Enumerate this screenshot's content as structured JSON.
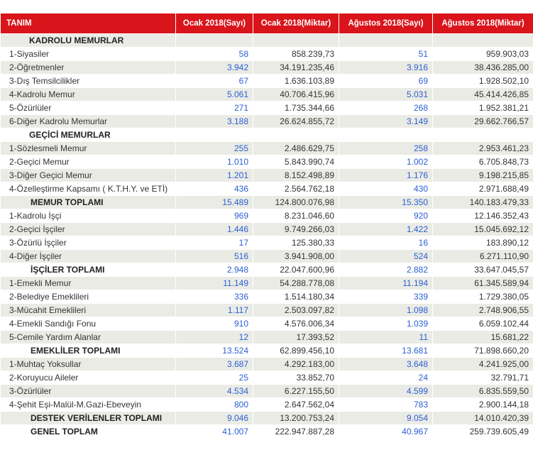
{
  "headers": [
    "TANIM",
    "Ocak 2018(Sayı)",
    "Ocak 2018(Miktar)",
    "Ağustos 2018(Sayı)",
    "Ağustos 2018(Miktar)"
  ],
  "rows": [
    {
      "type": "section",
      "name": "KADROLU MEMURLAR",
      "c1": "",
      "c2": "",
      "c3": "",
      "c4": ""
    },
    {
      "type": "item",
      "name": "1-Siyasiler",
      "c1": "58",
      "c2": "858.239,73",
      "c3": "51",
      "c4": "959.903,03"
    },
    {
      "type": "item",
      "name": "2-Öğretmenler",
      "c1": "3.942",
      "c2": "34.191.235,46",
      "c3": "3.916",
      "c4": "38.436.285,00"
    },
    {
      "type": "item",
      "name": "3-Dış Temsilcilikler",
      "c1": "67",
      "c2": "1.636.103,89",
      "c3": "69",
      "c4": "1.928.502,10"
    },
    {
      "type": "item",
      "name": "4-Kadrolu Memur",
      "c1": "5.061",
      "c2": "40.706.415,96",
      "c3": "5.031",
      "c4": "45.414.426,85"
    },
    {
      "type": "item",
      "name": "5-Özürlüler",
      "c1": "271",
      "c2": "1.735.344,66",
      "c3": "268",
      "c4": "1.952.381,21"
    },
    {
      "type": "item",
      "name": "6-Diğer Kadrolu Memurlar",
      "c1": "3.188",
      "c2": "26.624.855,72",
      "c3": "3.149",
      "c4": "29.662.766,57"
    },
    {
      "type": "section",
      "name": "GEÇİCİ MEMURLAR",
      "c1": "",
      "c2": "",
      "c3": "",
      "c4": ""
    },
    {
      "type": "item",
      "name": "1-Sözlesmeli Memur",
      "c1": "255",
      "c2": "2.486.629,75",
      "c3": "258",
      "c4": "2.953.461,23"
    },
    {
      "type": "item",
      "name": "2-Geçici Memur",
      "c1": "1.010",
      "c2": "5.843.990,74",
      "c3": "1.002",
      "c4": "6.705.848,73"
    },
    {
      "type": "item",
      "name": "3-Diğer Geçici Memur",
      "c1": "1.201",
      "c2": "8.152.498,89",
      "c3": "1.176",
      "c4": "9.198.215,85"
    },
    {
      "type": "item",
      "name": "4-Özelleştirme Kapsamı ( K.T.H.Y. ve ETİ)",
      "c1": "436",
      "c2": "2.564.762,18",
      "c3": "430",
      "c4": "2.971.688,49"
    },
    {
      "type": "total",
      "name": "MEMUR TOPLAMI",
      "c1": "15.489",
      "c2": "124.800.076,98",
      "c3": "15.350",
      "c4": "140.183.479,33"
    },
    {
      "type": "item",
      "name": "1-Kadrolu İşçi",
      "c1": "969",
      "c2": "8.231.046,60",
      "c3": "920",
      "c4": "12.146.352,43"
    },
    {
      "type": "item",
      "name": "2-Geçici İşçiler",
      "c1": "1.446",
      "c2": "9.749.266,03",
      "c3": "1.422",
      "c4": "15.045.692,12"
    },
    {
      "type": "item",
      "name": "3-Özürlü İşçiler",
      "c1": "17",
      "c2": "125.380,33",
      "c3": "16",
      "c4": "183.890,12"
    },
    {
      "type": "item",
      "name": "4-Diğer İşçiler",
      "c1": "516",
      "c2": "3.941.908,00",
      "c3": "524",
      "c4": "6.271.110,90"
    },
    {
      "type": "total",
      "name": "İŞÇİLER TOPLAMI",
      "c1": "2.948",
      "c2": "22.047.600,96",
      "c3": "2.882",
      "c4": "33.647.045,57"
    },
    {
      "type": "item",
      "name": "1-Emekli Memur",
      "c1": "11.149",
      "c2": "54.288.778,08",
      "c3": "11.194",
      "c4": "61.345.589,94"
    },
    {
      "type": "item",
      "name": "2-Belediye Emeklileri",
      "c1": "336",
      "c2": "1.514.180,34",
      "c3": "339",
      "c4": "1.729.380,05"
    },
    {
      "type": "item",
      "name": "3-Mücahit Emeklileri",
      "c1": "1.117",
      "c2": "2.503.097,82",
      "c3": "1.098",
      "c4": "2.748.906,55"
    },
    {
      "type": "item",
      "name": "4-Emekli Sandığı Fonu",
      "c1": "910",
      "c2": "4.576.006,34",
      "c3": "1.039",
      "c4": "6.059.102,44"
    },
    {
      "type": "item",
      "name": "5-Cemile Yardım Alanlar",
      "c1": "12",
      "c2": "17.393,52",
      "c3": "11",
      "c4": "15.681,22"
    },
    {
      "type": "total",
      "name": "EMEKLİLER TOPLAMI",
      "c1": "13.524",
      "c2": "62.899.456,10",
      "c3": "13.681",
      "c4": "71.898.660,20"
    },
    {
      "type": "item",
      "name": "1-Muhtaç Yoksullar",
      "c1": "3.687",
      "c2": "4.292.183,00",
      "c3": "3.648",
      "c4": "4.241.925,00"
    },
    {
      "type": "item",
      "name": "2-Koruyucu Aileler",
      "c1": "25",
      "c2": "33.852,70",
      "c3": "24",
      "c4": "32.791,71"
    },
    {
      "type": "item",
      "name": "3-Özürlüler",
      "c1": "4.534",
      "c2": "6.227.155,50",
      "c3": "4.599",
      "c4": "6.835.559,50"
    },
    {
      "type": "item",
      "name": "4-Şehit Eşi-Malül-M.Gazi-Ebeveyin",
      "c1": "800",
      "c2": "2.647.562,04",
      "c3": "783",
      "c4": "2.900.144,18"
    },
    {
      "type": "total",
      "name": "DESTEK VERİLENLER TOPLAMI",
      "c1": "9.046",
      "c2": "13.200.753,24",
      "c3": "9.054",
      "c4": "14.010.420,39"
    },
    {
      "type": "total",
      "name": "GENEL TOPLAM",
      "c1": "41.007",
      "c2": "222.947.887,28",
      "c3": "40.967",
      "c4": "259.739.605,49"
    }
  ]
}
